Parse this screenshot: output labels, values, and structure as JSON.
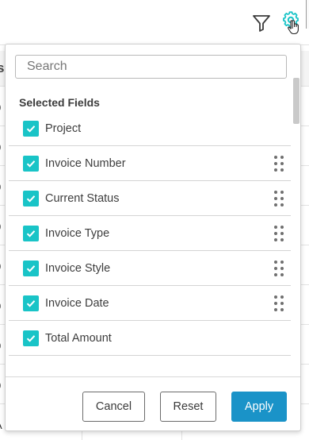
{
  "toolbar": {
    "filter_icon": "funnel-icon",
    "settings_icon": "gear-icon",
    "accent_color": "#19c4c7"
  },
  "background": {
    "header_fragment": "s",
    "cell_fragments": [
      "0",
      "0",
      "0",
      "0",
      "0",
      "0",
      "0",
      "0",
      "A"
    ]
  },
  "panel": {
    "search": {
      "value": "",
      "placeholder": "Search"
    },
    "section_title": "Selected Fields",
    "fields": [
      {
        "label": "Project",
        "checked": true,
        "draggable": false
      },
      {
        "label": "Invoice Number",
        "checked": true,
        "draggable": true
      },
      {
        "label": "Current Status",
        "checked": true,
        "draggable": true
      },
      {
        "label": "Invoice Type",
        "checked": true,
        "draggable": true
      },
      {
        "label": "Invoice Style",
        "checked": true,
        "draggable": true
      },
      {
        "label": "Invoice Date",
        "checked": true,
        "draggable": true
      },
      {
        "label": "Total Amount",
        "checked": true,
        "draggable": false
      }
    ],
    "buttons": {
      "cancel": "Cancel",
      "reset": "Reset",
      "apply": "Apply"
    },
    "colors": {
      "checkbox": "#19c4c7",
      "apply_button": "#1a93c8"
    }
  }
}
